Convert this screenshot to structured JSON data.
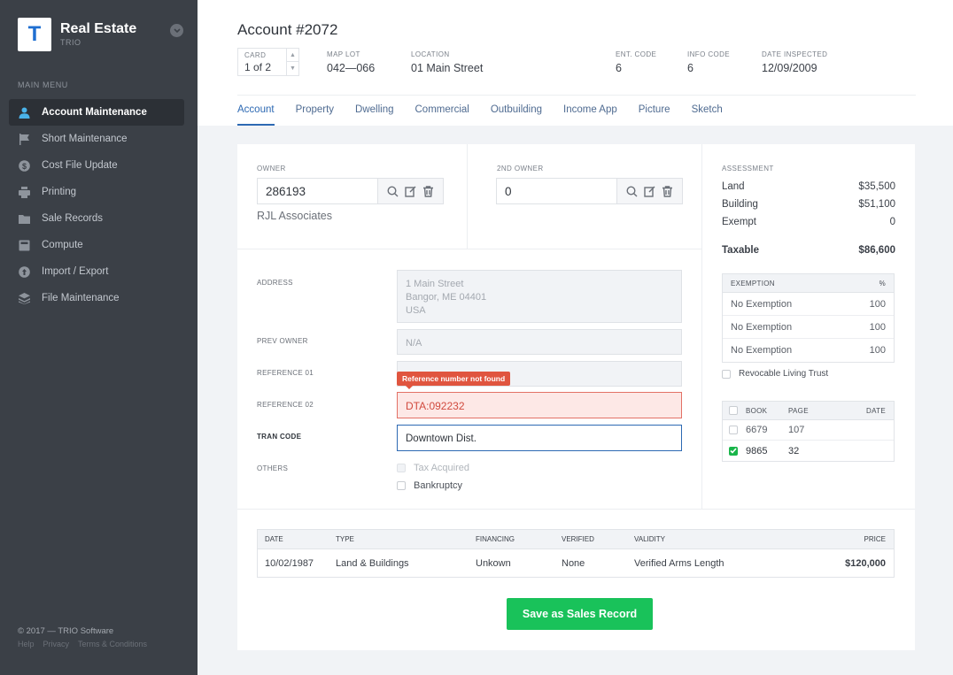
{
  "app": {
    "title": "Real Estate",
    "subtitle": "TRIO",
    "logo_letter": "T"
  },
  "sidebar": {
    "heading": "MAIN MENU",
    "items": [
      {
        "label": "Account Maintenance",
        "icon": "user-icon",
        "active": true
      },
      {
        "label": "Short Maintenance",
        "icon": "flag-icon"
      },
      {
        "label": "Cost File Update",
        "icon": "dollar-icon"
      },
      {
        "label": "Printing",
        "icon": "printer-icon"
      },
      {
        "label": "Sale Records",
        "icon": "folder-icon"
      },
      {
        "label": "Compute",
        "icon": "calculator-icon"
      },
      {
        "label": "Import / Export",
        "icon": "import-export-icon"
      },
      {
        "label": "File Maintenance",
        "icon": "layers-icon"
      }
    ],
    "footer": {
      "copyright": "© 2017 — TRIO Software",
      "help": "Help",
      "privacy": "Privacy",
      "terms": "Terms & Conditions"
    }
  },
  "header": {
    "title": "Account #2072",
    "card": {
      "label": "CARD",
      "value": "1 of 2"
    },
    "map_lot": {
      "label": "MAP LOT",
      "value": "042—066"
    },
    "location": {
      "label": "LOCATION",
      "value": "01 Main Street"
    },
    "ent_code": {
      "label": "ENT. CODE",
      "value": "6"
    },
    "info_code": {
      "label": "INFO CODE",
      "value": "6"
    },
    "date_inspected": {
      "label": "DATE INSPECTED",
      "value": "12/09/2009"
    }
  },
  "tabs": [
    "Account",
    "Property",
    "Dwelling",
    "Commercial",
    "Outbuilding",
    "Income App",
    "Picture",
    "Sketch"
  ],
  "owner": {
    "label": "OWNER",
    "value": "286193",
    "name": "RJL Associates"
  },
  "second_owner": {
    "label": "2ND OWNER",
    "value": "0"
  },
  "form": {
    "address": {
      "label": "ADDRESS",
      "line1": "1 Main Street",
      "line2": "Bangor, ME 04401",
      "line3": "USA"
    },
    "prev_owner": {
      "label": "PREV OWNER",
      "value": "N/A"
    },
    "reference01": {
      "label": "REFERENCE 01",
      "value": ""
    },
    "reference02": {
      "label": "REFERENCE 02",
      "value": "DTA:092232",
      "error": "Reference number not found"
    },
    "tran_code": {
      "label": "TRAN CODE",
      "value": "Downtown Dist."
    },
    "others": {
      "label": "OTHERS",
      "tax_acquired": "Tax Acquired",
      "bankruptcy": "Bankruptcy"
    }
  },
  "assessment": {
    "label": "ASSESSMENT",
    "land": {
      "label": "Land",
      "value": "$35,500"
    },
    "building": {
      "label": "Building",
      "value": "$51,100"
    },
    "exempt": {
      "label": "Exempt",
      "value": "0"
    },
    "taxable": {
      "label": "Taxable",
      "value": "$86,600"
    }
  },
  "exemptions": {
    "headers": {
      "name": "EXEMPTION",
      "pct": "%"
    },
    "rows": [
      {
        "name": "No Exemption",
        "pct": "100"
      },
      {
        "name": "No Exemption",
        "pct": "100"
      },
      {
        "name": "No Exemption",
        "pct": "100"
      }
    ],
    "revocable_trust": "Revocable Living Trust"
  },
  "book_page": {
    "headers": {
      "book": "BOOK",
      "page": "PAGE",
      "date": "DATE"
    },
    "rows": [
      {
        "book": "6679",
        "page": "107",
        "date": "",
        "checked": false
      },
      {
        "book": "9865",
        "page": "32",
        "date": "",
        "checked": true
      }
    ]
  },
  "sales": {
    "headers": {
      "date": "DATE",
      "type": "TYPE",
      "financing": "FINANCING",
      "verified": "VERIFIED",
      "validity": "VALIDITY",
      "price": "PRICE"
    },
    "rows": [
      {
        "date": "10/02/1987",
        "type": "Land & Buildings",
        "financing": "Unkown",
        "verified": "None",
        "validity": "Verified Arms Length",
        "price": "$120,000"
      }
    ]
  },
  "actions": {
    "save_label": "Save as Sales Record"
  },
  "colors": {
    "sidebar_bg": "#3b4047",
    "accent": "#2d69b3",
    "error": "#e0553f",
    "success": "#19c25a"
  }
}
